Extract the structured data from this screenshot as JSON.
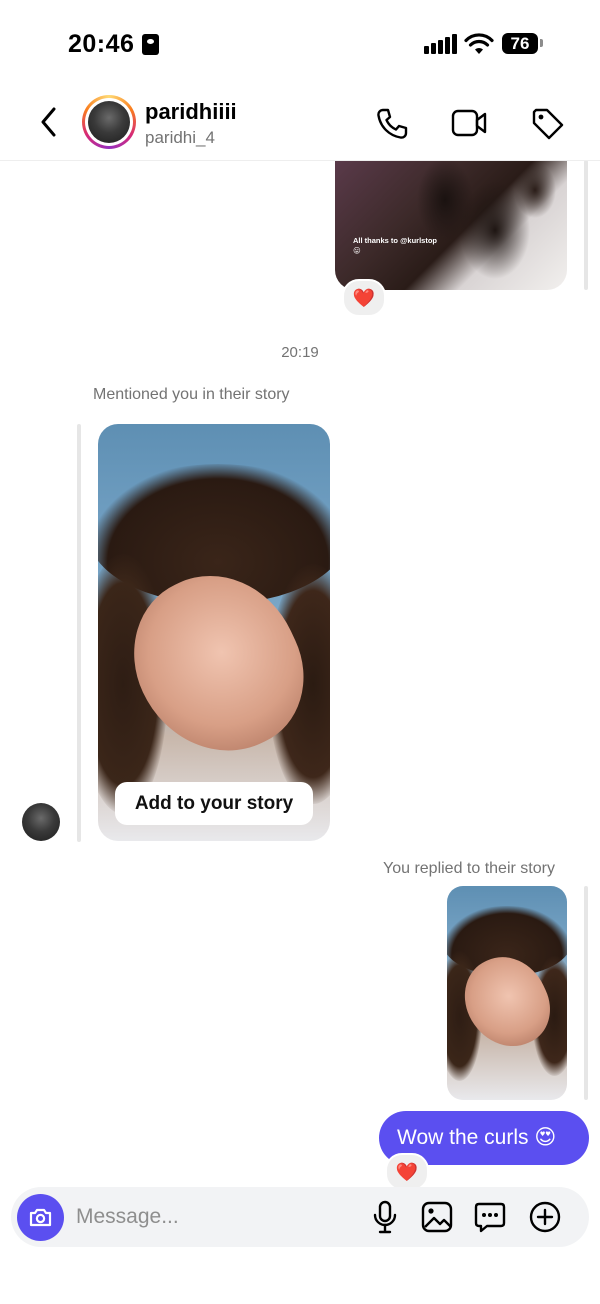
{
  "status_bar": {
    "time": "20:46",
    "battery": "76"
  },
  "header": {
    "name": "paridhiiii",
    "username": "paridhi_4"
  },
  "story_top": {
    "caption": "All thanks to @kurlstop 😛",
    "reaction": "❤️"
  },
  "chat": {
    "timestamp": "20:19",
    "mention_label": "Mentioned you in their story",
    "add_to_story_label": "Add to your story",
    "replied_label": "You replied to their story",
    "message_text": "Wow the curls 😍",
    "message_reaction": "❤️"
  },
  "composer": {
    "placeholder": "Message..."
  },
  "colors": {
    "accent": "#5b4ff0",
    "muted_text": "#737373",
    "composer_bg": "#f2f3f5"
  }
}
